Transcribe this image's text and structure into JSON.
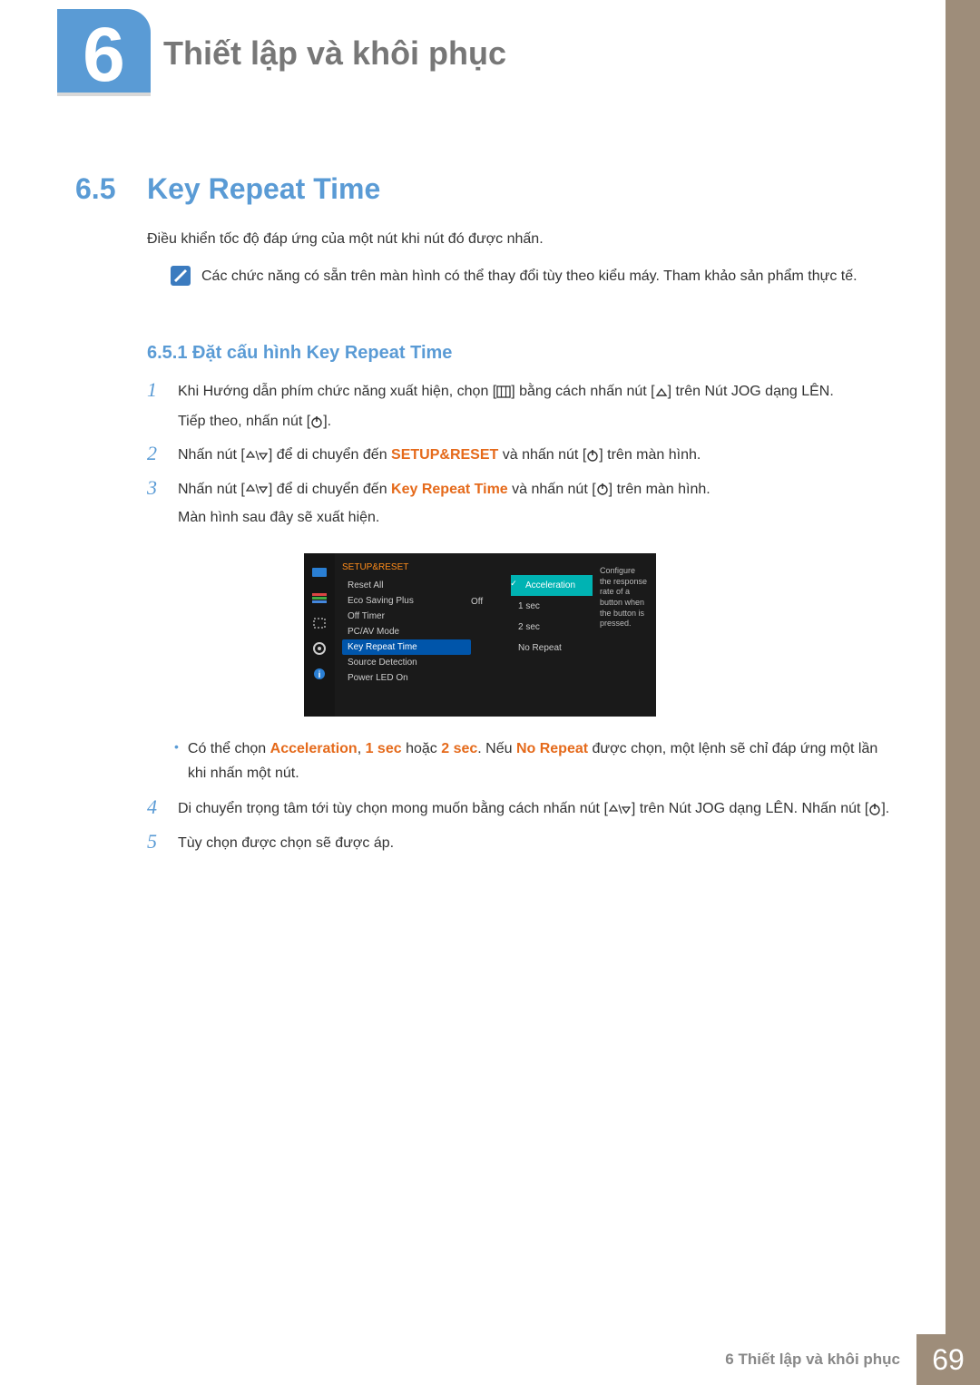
{
  "chapter": {
    "number": "6",
    "title": "Thiết lập và khôi phục"
  },
  "section": {
    "number": "6.5",
    "title": "Key Repeat Time"
  },
  "intro": "Điều khiển tốc độ đáp ứng của một nút khi nút đó được nhấn.",
  "note": "Các chức năng có sẵn trên màn hình có thể thay đổi tùy theo kiểu máy. Tham khảo sản phẩm thực tế.",
  "subsection": "6.5.1  Đặt cấu hình Key Repeat Time",
  "steps": {
    "s1a": "Khi Hướng dẫn phím chức năng xuất hiện, chọn [",
    "s1b": "] bằng cách nhấn nút [",
    "s1c": "] trên Nút JOG dạng LÊN.",
    "s1d": "Tiếp theo, nhấn nút [",
    "s1e": "].",
    "s2a": "Nhấn nút [",
    "s2b": "] để di chuyển đến ",
    "s2kw": "SETUP&RESET",
    "s2c": " và nhấn nút [",
    "s2d": "] trên màn hình.",
    "s3a": "Nhấn nút [",
    "s3b": "] để di chuyển đến ",
    "s3kw": "Key Repeat Time",
    "s3c": " và nhấn nút [",
    "s3d": "] trên màn hình.",
    "s3e": "Màn hình sau đây sẽ xuất hiện.",
    "bullet_a": "Có thể chọn ",
    "bullet_accel": "Acceleration",
    "bullet_comma1": ", ",
    "bullet_1sec": "1 sec",
    "bullet_or": " hoặc ",
    "bullet_2sec": "2 sec",
    "bullet_dot2": ". Nếu ",
    "bullet_norepeat": "No Repeat",
    "bullet_tail": " được chọn, một lệnh sẽ chỉ đáp ứng một lần khi nhấn một nút.",
    "s4a": "Di chuyển trọng tâm tới tùy chọn mong muốn bằng cách nhấn nút [",
    "s4b": "] trên Nút JOG dạng LÊN. Nhấn nút [",
    "s4c": "].",
    "s5": "Tùy chọn được chọn sẽ được áp."
  },
  "osd": {
    "title": "SETUP&RESET",
    "items": [
      "Reset All",
      "Eco Saving Plus",
      "Off Timer",
      "PC/AV Mode",
      "Key Repeat Time",
      "Source Detection",
      "Power LED On"
    ],
    "value_off": "Off",
    "sub": [
      "Acceleration",
      "1 sec",
      "2 sec",
      "No Repeat"
    ],
    "desc": "Configure the response rate of a button when the button is pressed."
  },
  "footer": {
    "label": "6 Thiết lập và khôi phục",
    "page": "69"
  }
}
